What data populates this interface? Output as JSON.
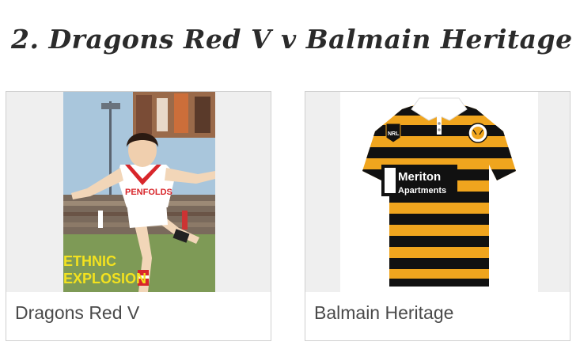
{
  "page": {
    "title": "2. Dragons Red V v Balmain Heritage"
  },
  "cards": [
    {
      "caption": "Dragons Red V",
      "image_text": [
        "PENFOLDS",
        "ETHNIC",
        "EXPLOSION"
      ]
    },
    {
      "caption": "Balmain Heritage",
      "image_text": [
        "NRL",
        "Meriton",
        "Apartments"
      ]
    }
  ],
  "colors": {
    "heading": "#2b2b2b",
    "caption": "#4a4a4a",
    "card_border": "#cfcfcf",
    "media_bg": "#efefef",
    "jersey_gold": "#f0a51e",
    "jersey_black": "#111111",
    "dragons_red": "#d8262b"
  }
}
